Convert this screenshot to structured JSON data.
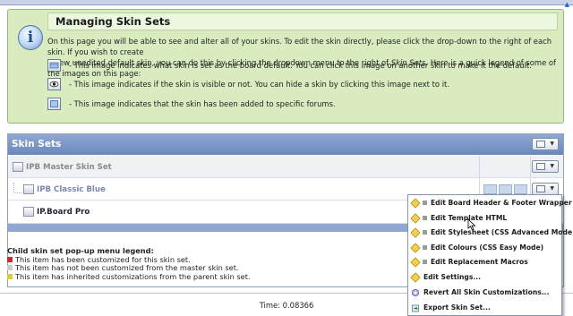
{
  "page": {
    "footer_time": "Time: 0.08366"
  },
  "info": {
    "title": "Managing Skin Sets",
    "intro_1": "On this page you will be able to see and alter all of your skins. To edit the skin directly, please click the drop-down to the right of each skin. If you wish to create",
    "intro_2": "a new unedited default skin, you can do this by clicking the dropdown menu to the right of ",
    "intro_em": "Skin Sets",
    "intro_3": ". Here is a quick legend of some of the images on this page:",
    "legend": [
      {
        "icon": "default-skin-icon",
        "text": "- This image indicates what skin is set as the board default. You can click this image on another skin to make it the default."
      },
      {
        "icon": "visible-eye-icon",
        "text": "- This image indicates if the skin is visible or not. You can hide a skin by clicking this image next to it."
      },
      {
        "icon": "forums-skin-icon",
        "text": "- This image indicates that the skin has been added to specific forums."
      }
    ]
  },
  "skins": {
    "header": "Skin Sets",
    "rows": [
      {
        "name": "IPB Master Skin Set",
        "color": "#8a8a8a"
      },
      {
        "name": "IPB Classic Blue",
        "color": "#7d86a8"
      },
      {
        "name": "IP.Board Pro",
        "color": "#1f2430"
      }
    ]
  },
  "child_legend": {
    "title": "Child skin set pop-up menu legend:",
    "items": [
      {
        "color": "#cc2b2b",
        "text": "This item has been customized for this skin set."
      },
      {
        "color": "#cccccc",
        "text": "This item has not been customized from the master skin set."
      },
      {
        "color": "#d6cf3a",
        "text": "This item has inherited customizations from the parent skin set."
      }
    ]
  },
  "menu": {
    "items": [
      {
        "label": "Edit Board Header & Footer Wrapper",
        "icon": "pencil-icon"
      },
      {
        "label": "Edit Template HTML",
        "icon": "pencil-icon"
      },
      {
        "label": "Edit Stylesheet (CSS Advanced Mode)",
        "icon": "pencil-icon"
      },
      {
        "label": "Edit Colours (CSS Easy Mode)",
        "icon": "pencil-icon"
      },
      {
        "label": "Edit Replacement Macros",
        "icon": "pencil-icon"
      },
      {
        "label": "Edit Settings...",
        "icon": "pencil-icon"
      },
      {
        "label": "Revert All Skin Customizations...",
        "icon": "revert-icon"
      },
      {
        "label": "Export Skin Set...",
        "icon": "export-icon"
      }
    ]
  },
  "colors": {
    "info_bg": "#d8ecbf",
    "panel_header": "#7a94c6"
  }
}
